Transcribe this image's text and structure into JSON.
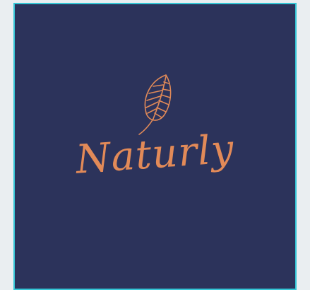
{
  "brand": {
    "name": "Naturly",
    "icon": "leaf-icon"
  },
  "colors": {
    "background": "#2c335b",
    "accent": "#e28a58",
    "frame": "#35c6d6",
    "page": "#eaeef1"
  }
}
